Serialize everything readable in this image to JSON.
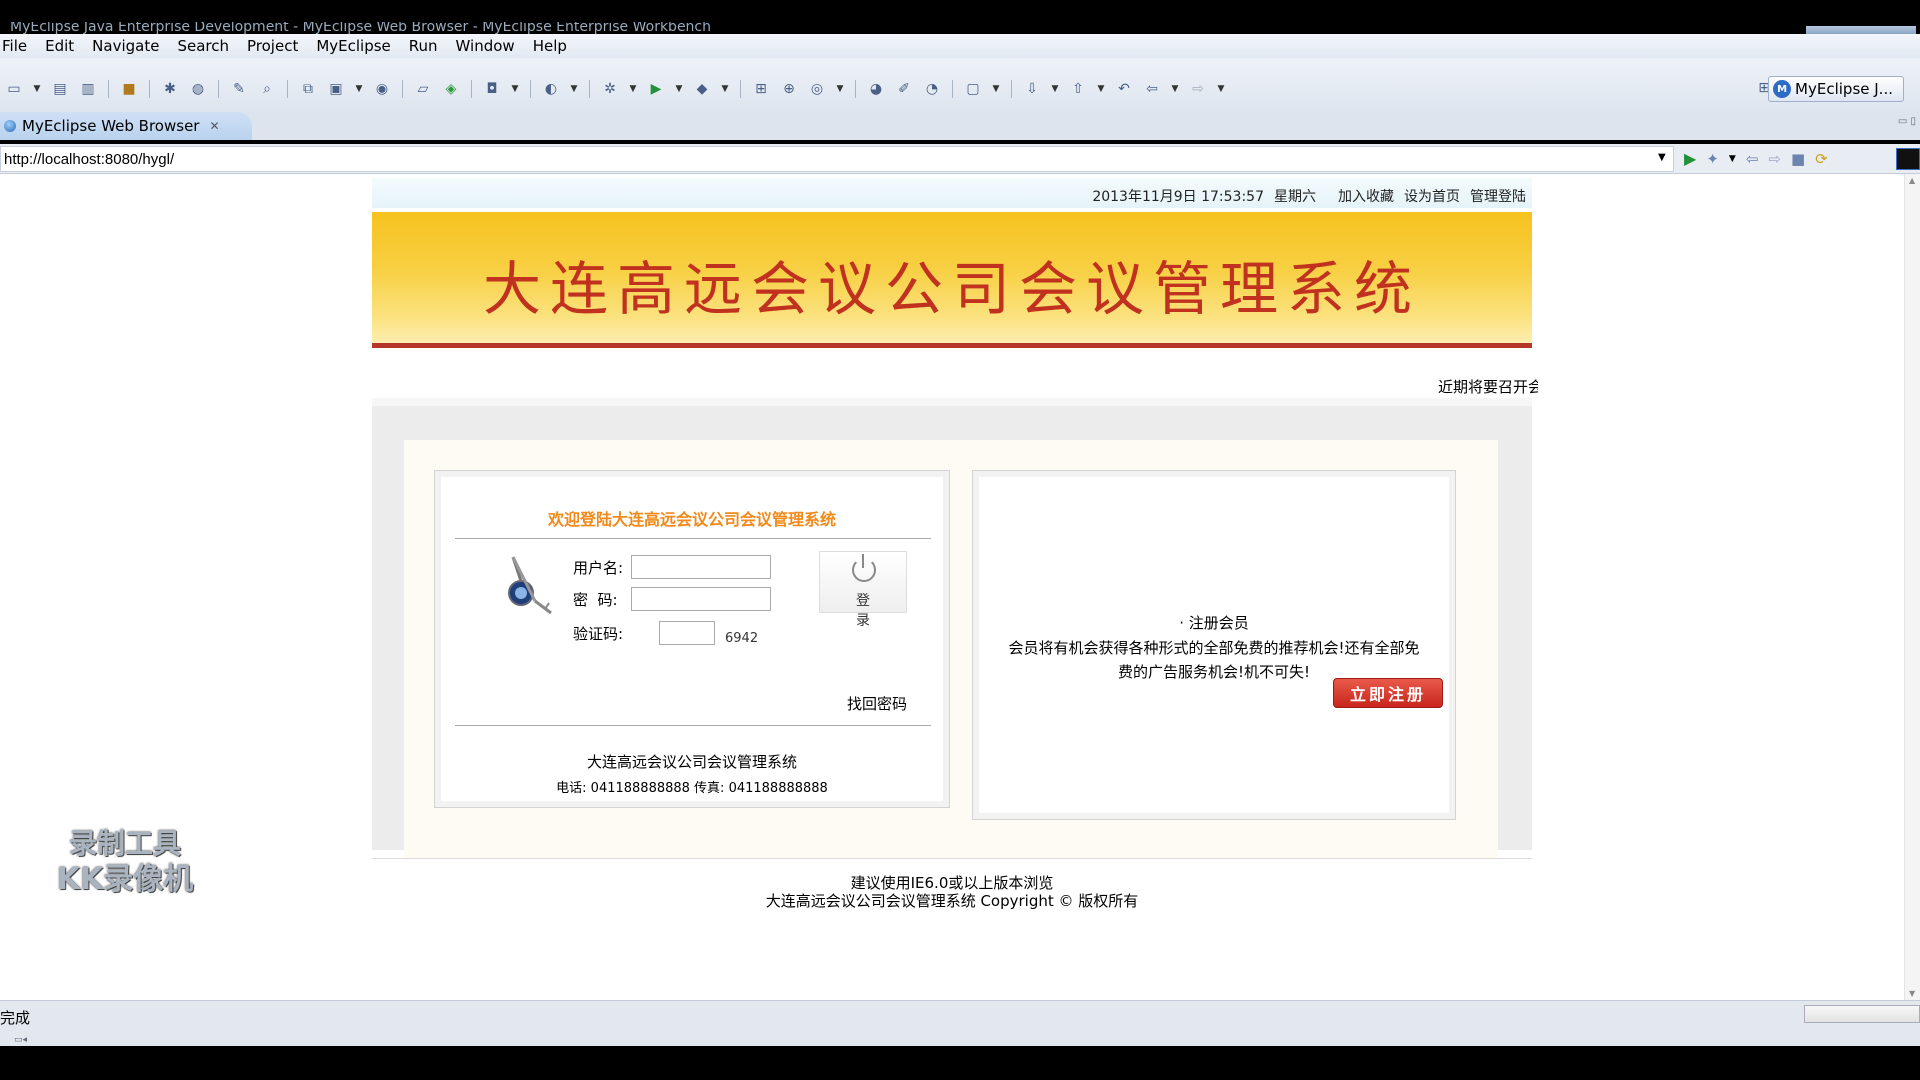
{
  "window": {
    "title": "MyEclipse Java Enterprise Development - MyEclipse Web Browser - MyEclipse Enterprise Workbench"
  },
  "menu": [
    "File",
    "Edit",
    "Navigate",
    "Search",
    "Project",
    "MyEclipse",
    "Run",
    "Window",
    "Help"
  ],
  "perspective": {
    "label": "MyEclipse J..."
  },
  "tab": {
    "label": "MyEclipse Web Browser"
  },
  "browser": {
    "url": "http://localhost:8080/hygl/"
  },
  "topbar": {
    "datetime": "2013年11月9日 17:53:57",
    "weekday": "星期六",
    "links": [
      "加入收藏",
      "设为首页",
      "管理登陆"
    ]
  },
  "banner": {
    "title": "大连高远会议公司会议管理系统"
  },
  "marquee": "近期将要召开会",
  "login": {
    "welcome": "欢迎登陆大连高远会议公司会议管理系统",
    "username_label": "用户名:",
    "password_label": "密  码:",
    "captcha_label": "验证码:",
    "captcha_code": "6942",
    "username_value": "",
    "password_value": "",
    "captcha_value": "",
    "login_button": "登录",
    "forgot_password": "找回密码",
    "system_name": "大连高远会议公司会议管理系统",
    "contact": "电话: 041188888888 传真: 041188888888"
  },
  "register": {
    "heading": "· 注册会员",
    "description": "会员将有机会获得各种形式的全部免费的推荐机会!还有全部免费的广告服务机会!机不可失!",
    "button": "立即注册"
  },
  "footer": {
    "line1": "建议使用IE6.0或以上版本浏览",
    "line2": "大连高远会议公司会议管理系统 Copyright © 版权所有"
  },
  "watermark": {
    "line1": "录制工具",
    "line2": "KK录像机"
  },
  "status": {
    "text": "完成"
  },
  "colors": {
    "banner_title": "#c0311f",
    "welcome_text": "#f08a1b",
    "register_button": "#d33a2c"
  }
}
